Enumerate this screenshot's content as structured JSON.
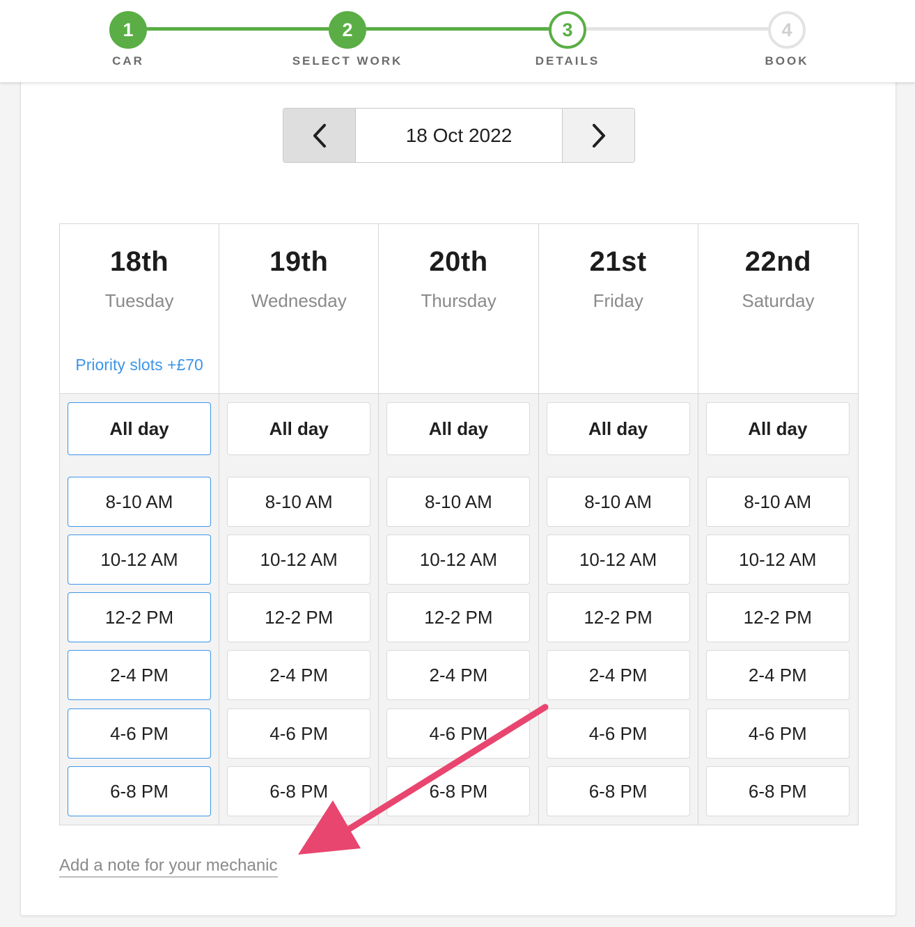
{
  "steps": [
    {
      "number": "1",
      "label": "CAR",
      "state": "done"
    },
    {
      "number": "2",
      "label": "SELECT WORK",
      "state": "done"
    },
    {
      "number": "3",
      "label": "DETAILS",
      "state": "current"
    },
    {
      "number": "4",
      "label": "BOOK",
      "state": "pending"
    }
  ],
  "date_nav": {
    "prev_icon": "chevron-left-icon",
    "date": "18 Oct 2022",
    "next_icon": "chevron-right-icon"
  },
  "days": [
    {
      "num": "18th",
      "name": "Tuesday",
      "priority": "Priority slots +£70",
      "selected": true,
      "all_day": "All day",
      "slots": [
        "8-10 AM",
        "10-12 AM",
        "12-2 PM",
        "2-4 PM",
        "4-6 PM",
        "6-8 PM"
      ]
    },
    {
      "num": "19th",
      "name": "Wednesday",
      "priority": "",
      "selected": false,
      "all_day": "All day",
      "slots": [
        "8-10 AM",
        "10-12 AM",
        "12-2 PM",
        "2-4 PM",
        "4-6 PM",
        "6-8 PM"
      ]
    },
    {
      "num": "20th",
      "name": "Thursday",
      "priority": "",
      "selected": false,
      "all_day": "All day",
      "slots": [
        "8-10 AM",
        "10-12 AM",
        "12-2 PM",
        "2-4 PM",
        "4-6 PM",
        "6-8 PM"
      ]
    },
    {
      "num": "21st",
      "name": "Friday",
      "priority": "",
      "selected": false,
      "all_day": "All day",
      "slots": [
        "8-10 AM",
        "10-12 AM",
        "12-2 PM",
        "2-4 PM",
        "4-6 PM",
        "6-8 PM"
      ]
    },
    {
      "num": "22nd",
      "name": "Saturday",
      "priority": "",
      "selected": false,
      "all_day": "All day",
      "slots": [
        "8-10 AM",
        "10-12 AM",
        "12-2 PM",
        "2-4 PM",
        "4-6 PM",
        "6-8 PM"
      ]
    }
  ],
  "note_link": "Add a note for your mechanic",
  "colors": {
    "step_green": "#5aae45",
    "accent_blue": "#3d95e8",
    "annotation_arrow": "#e8466f"
  }
}
